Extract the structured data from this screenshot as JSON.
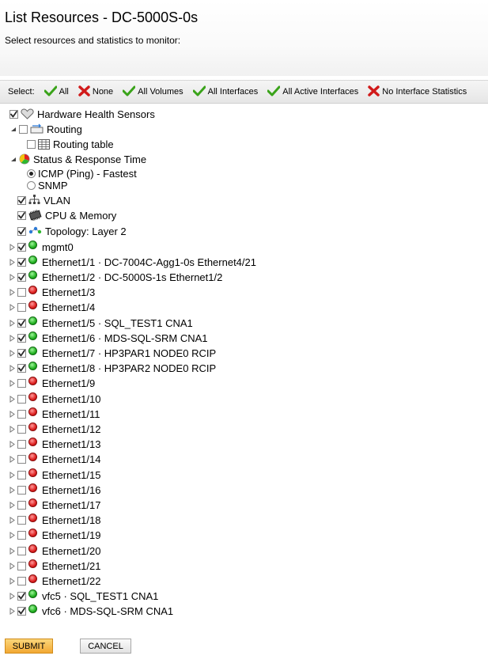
{
  "page": {
    "title": "List Resources - DC-5000S-0s",
    "subtitle": "Select resources and statistics to monitor:"
  },
  "select_bar": {
    "label": "Select:",
    "buttons": [
      {
        "label": "All",
        "icon": "check-icon"
      },
      {
        "label": "None",
        "icon": "x-icon"
      },
      {
        "label": "All Volumes",
        "icon": "check-icon"
      },
      {
        "label": "All Interfaces",
        "icon": "check-icon"
      },
      {
        "label": "All Active Interfaces",
        "icon": "check-icon"
      },
      {
        "label": "No Interface Statistics",
        "icon": "x-icon"
      }
    ]
  },
  "tree": [
    {
      "label": "Hardware Health Sensors",
      "checked": true,
      "icon": "heart-icon"
    },
    {
      "label": "Routing",
      "checked": false,
      "icon": "routing-icon",
      "expanded": true
    },
    {
      "label": "Routing table",
      "checked": false,
      "icon": "table-icon"
    },
    {
      "label": "Status & Response Time",
      "icon": "status-icon",
      "expanded": true
    },
    {
      "label": "ICMP (Ping) - Fastest",
      "radio": true,
      "selected": true
    },
    {
      "label": "SNMP",
      "radio": true,
      "selected": false
    },
    {
      "label": "VLAN",
      "checked": true,
      "icon": "vlan-icon"
    },
    {
      "label": "CPU & Memory",
      "checked": true,
      "icon": "chip-icon"
    },
    {
      "label": "Topology: Layer 2",
      "checked": true,
      "icon": "topology-icon"
    },
    {
      "label": "mgmt0",
      "checked": true,
      "status": "up"
    },
    {
      "label": "Ethernet1/1 · DC-7004C-Agg1-0s Ethernet4/21",
      "checked": true,
      "status": "up"
    },
    {
      "label": "Ethernet1/2 · DC-5000S-1s Ethernet1/2",
      "checked": true,
      "status": "up"
    },
    {
      "label": "Ethernet1/3",
      "checked": false,
      "status": "down"
    },
    {
      "label": "Ethernet1/4",
      "checked": false,
      "status": "down"
    },
    {
      "label": "Ethernet1/5 · SQL_TEST1 CNA1",
      "checked": true,
      "status": "up"
    },
    {
      "label": "Ethernet1/6 · MDS-SQL-SRM CNA1",
      "checked": true,
      "status": "up"
    },
    {
      "label": "Ethernet1/7 · HP3PAR1 NODE0 RCIP",
      "checked": true,
      "status": "up"
    },
    {
      "label": "Ethernet1/8 · HP3PAR2 NODE0 RCIP",
      "checked": true,
      "status": "up"
    },
    {
      "label": "Ethernet1/9",
      "checked": false,
      "status": "down"
    },
    {
      "label": "Ethernet1/10",
      "checked": false,
      "status": "down"
    },
    {
      "label": "Ethernet1/11",
      "checked": false,
      "status": "down"
    },
    {
      "label": "Ethernet1/12",
      "checked": false,
      "status": "down"
    },
    {
      "label": "Ethernet1/13",
      "checked": false,
      "status": "down"
    },
    {
      "label": "Ethernet1/14",
      "checked": false,
      "status": "down"
    },
    {
      "label": "Ethernet1/15",
      "checked": false,
      "status": "down"
    },
    {
      "label": "Ethernet1/16",
      "checked": false,
      "status": "down"
    },
    {
      "label": "Ethernet1/17",
      "checked": false,
      "status": "down"
    },
    {
      "label": "Ethernet1/18",
      "checked": false,
      "status": "down"
    },
    {
      "label": "Ethernet1/19",
      "checked": false,
      "status": "down"
    },
    {
      "label": "Ethernet1/20",
      "checked": false,
      "status": "down"
    },
    {
      "label": "Ethernet1/21",
      "checked": false,
      "status": "down"
    },
    {
      "label": "Ethernet1/22",
      "checked": false,
      "status": "down"
    },
    {
      "label": "vfc5 · SQL_TEST1 CNA1",
      "checked": true,
      "status": "up"
    },
    {
      "label": "vfc6 · MDS-SQL-SRM CNA1",
      "checked": true,
      "status": "up"
    }
  ],
  "actions": {
    "submit_label": "SUBMIT",
    "cancel_label": "CANCEL"
  },
  "colors": {
    "status_up": "#22b122",
    "status_down": "#dd1f1f",
    "check_green": "#3aa31a",
    "x_red": "#d11a1a",
    "submit_bg": "#f2a833"
  }
}
